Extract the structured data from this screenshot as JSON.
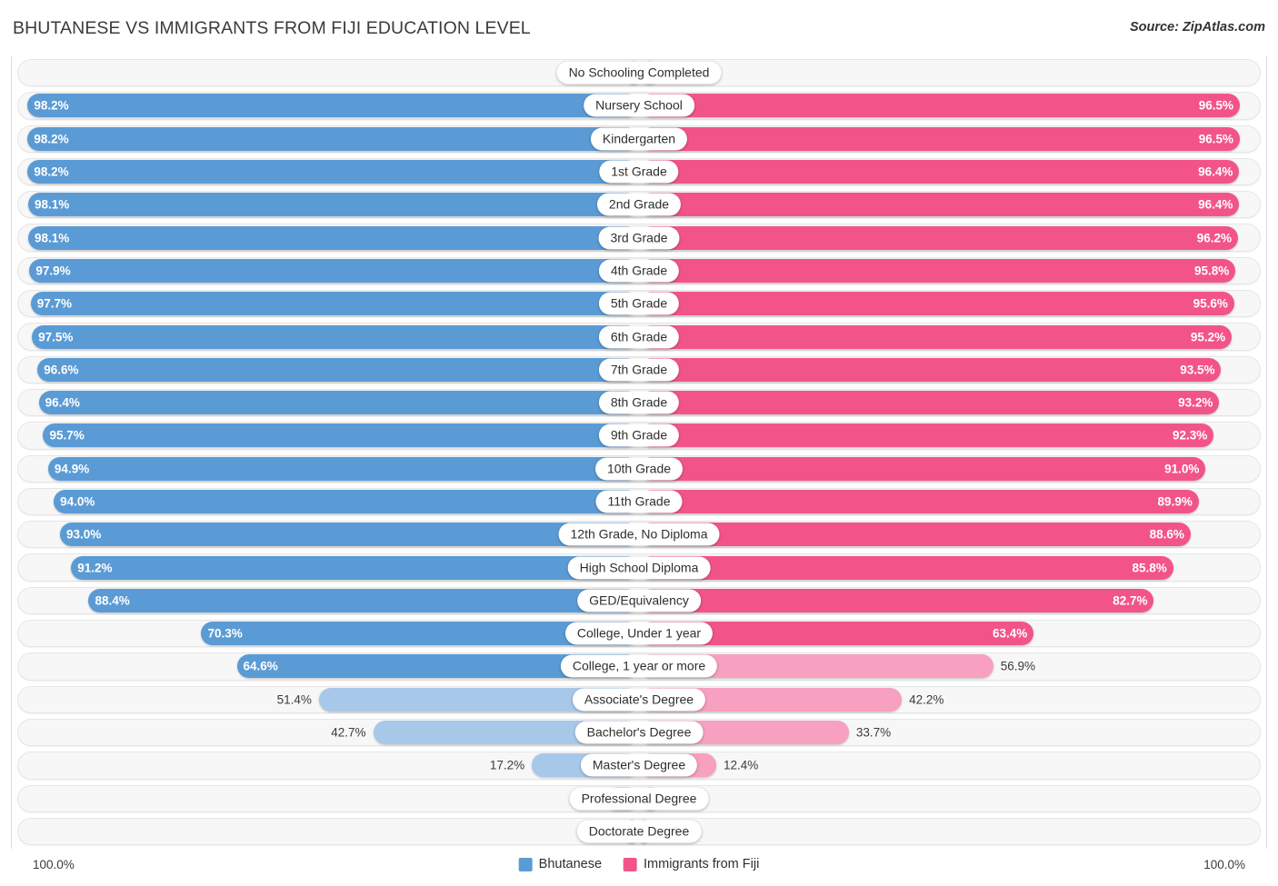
{
  "header": {
    "title": "BHUTANESE VS IMMIGRANTS FROM FIJI EDUCATION LEVEL",
    "source": "Source: ZipAtlas.com"
  },
  "footer": {
    "axis_left": "100.0%",
    "axis_right": "100.0%",
    "legend": [
      {
        "label": "Bhutanese",
        "color": "#5b9bd5"
      },
      {
        "label": "Immigrants from Fiji",
        "color": "#f2548a"
      }
    ]
  },
  "colors": {
    "blue_strong": "#5b9bd5",
    "blue_light": "#a8c8ea",
    "pink_strong": "#f2548a",
    "pink_light": "#f7a0bf",
    "track": "#f7f7f7",
    "text": "#3b3b3b"
  },
  "chart_data": {
    "type": "bar",
    "title": "BHUTANESE VS IMMIGRANTS FROM FIJI EDUCATION LEVEL",
    "xlabel": "",
    "ylabel": "",
    "orientation": "horizontal-diverging",
    "axis_max": 100.0,
    "axis_left_label": "100.0%",
    "axis_right_label": "100.0%",
    "legend_position": "bottom-center",
    "grid": false,
    "categories": [
      "No Schooling Completed",
      "Nursery School",
      "Kindergarten",
      "1st Grade",
      "2nd Grade",
      "3rd Grade",
      "4th Grade",
      "5th Grade",
      "6th Grade",
      "7th Grade",
      "8th Grade",
      "9th Grade",
      "10th Grade",
      "11th Grade",
      "12th Grade, No Diploma",
      "High School Diploma",
      "GED/Equivalency",
      "College, Under 1 year",
      "College, 1 year or more",
      "Associate's Degree",
      "Bachelor's Degree",
      "Master's Degree",
      "Professional Degree",
      "Doctorate Degree"
    ],
    "series": [
      {
        "name": "Bhutanese",
        "color": "#5b9bd5",
        "side": "left",
        "values": [
          1.8,
          98.2,
          98.2,
          98.2,
          98.1,
          98.1,
          97.9,
          97.7,
          97.5,
          96.6,
          96.4,
          95.7,
          94.9,
          94.0,
          93.0,
          91.2,
          88.4,
          70.3,
          64.6,
          51.4,
          42.7,
          17.2,
          5.4,
          2.3
        ],
        "labels": [
          "1.8%",
          "98.2%",
          "98.2%",
          "98.2%",
          "98.1%",
          "98.1%",
          "97.9%",
          "97.7%",
          "97.5%",
          "96.6%",
          "96.4%",
          "95.7%",
          "94.9%",
          "94.0%",
          "93.0%",
          "91.2%",
          "88.4%",
          "70.3%",
          "64.6%",
          "51.4%",
          "42.7%",
          "17.2%",
          "5.4%",
          "2.3%"
        ]
      },
      {
        "name": "Immigrants from Fiji",
        "color": "#f2548a",
        "side": "right",
        "values": [
          3.5,
          96.5,
          96.5,
          96.4,
          96.4,
          96.2,
          95.8,
          95.6,
          95.2,
          93.5,
          93.2,
          92.3,
          91.0,
          89.9,
          88.6,
          85.8,
          82.7,
          63.4,
          56.9,
          42.2,
          33.7,
          12.4,
          3.7,
          1.6
        ],
        "labels": [
          "3.5%",
          "96.5%",
          "96.5%",
          "96.4%",
          "96.4%",
          "96.2%",
          "95.8%",
          "95.6%",
          "95.2%",
          "93.5%",
          "93.2%",
          "92.3%",
          "91.0%",
          "89.9%",
          "88.6%",
          "85.8%",
          "82.7%",
          "63.4%",
          "56.9%",
          "42.2%",
          "33.7%",
          "12.4%",
          "3.7%",
          "1.6%"
        ]
      }
    ]
  }
}
